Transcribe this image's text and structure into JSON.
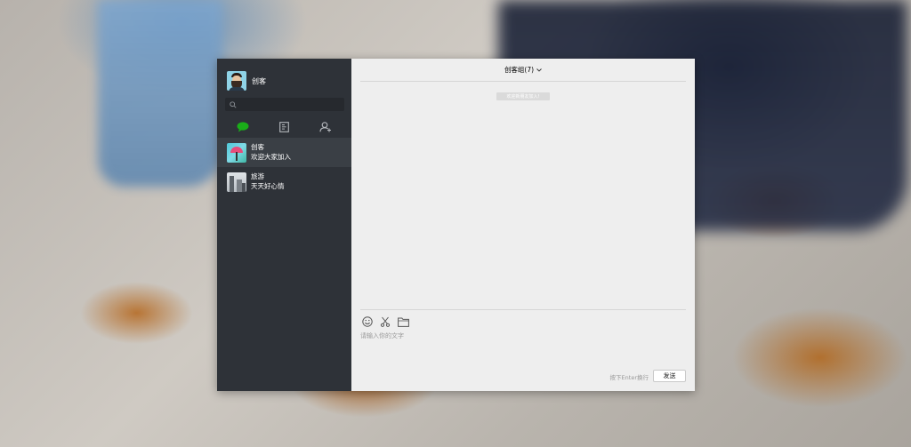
{
  "profile": {
    "name": "创客"
  },
  "search": {
    "placeholder": ""
  },
  "tabs": [
    {
      "icon": "chat-bubble-icon",
      "active": true,
      "color": "#1aad19"
    },
    {
      "icon": "contacts-book-icon",
      "active": false
    },
    {
      "icon": "add-user-icon",
      "active": false
    }
  ],
  "chats": [
    {
      "name": "创客",
      "last_message": "欢迎大家加入",
      "active": true
    },
    {
      "name": "旅游",
      "last_message": "天天好心情",
      "active": false
    }
  ],
  "main": {
    "title": "创客组(7)",
    "system_message": "欢迎新朋友加入!",
    "input_placeholder": "请输入你的文字",
    "send_hint": "按下Enter换行",
    "send_label": "发送"
  },
  "toolbar": [
    {
      "icon": "emoji-icon"
    },
    {
      "icon": "scissors-icon"
    },
    {
      "icon": "folder-icon"
    }
  ],
  "colors": {
    "sidebar": "#2e3238",
    "active_item": "#3a3f45",
    "main_bg": "#eeeeee",
    "accent": "#1aad19"
  }
}
